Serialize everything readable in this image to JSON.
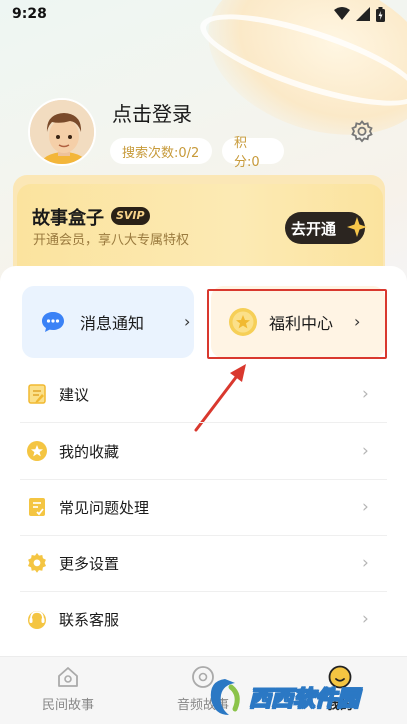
{
  "status": {
    "time": "9:28"
  },
  "profile": {
    "login_text": "点击登录",
    "search_count": "搜索次数:0/2",
    "points": "积分:0"
  },
  "vip": {
    "title": "故事盒子",
    "badge": "SVIP",
    "subtitle": "开通会员，享八大专属特权",
    "button": "去开通"
  },
  "quick": {
    "messages": "消息通知",
    "welfare": "福利中心",
    "arrow": "›"
  },
  "menu": [
    {
      "label": "建议",
      "icon": "suggestion-icon"
    },
    {
      "label": "我的收藏",
      "icon": "star-icon"
    },
    {
      "label": "常见问题处理",
      "icon": "faq-icon"
    },
    {
      "label": "更多设置",
      "icon": "gear-icon"
    },
    {
      "label": "联系客服",
      "icon": "headset-icon"
    }
  ],
  "menu_chevron": "›",
  "tabs": [
    {
      "label": "民间故事",
      "icon": "home-icon"
    },
    {
      "label": "音频故事",
      "icon": "audio-icon"
    },
    {
      "label": "我的",
      "icon": "profile-icon"
    }
  ],
  "watermark": "西西软件园",
  "colors": {
    "accent_gold": "#c79a3a",
    "vip_bg": "#fbe39e",
    "highlight_red": "#d9382e",
    "message_blue": "#3b82f6"
  }
}
